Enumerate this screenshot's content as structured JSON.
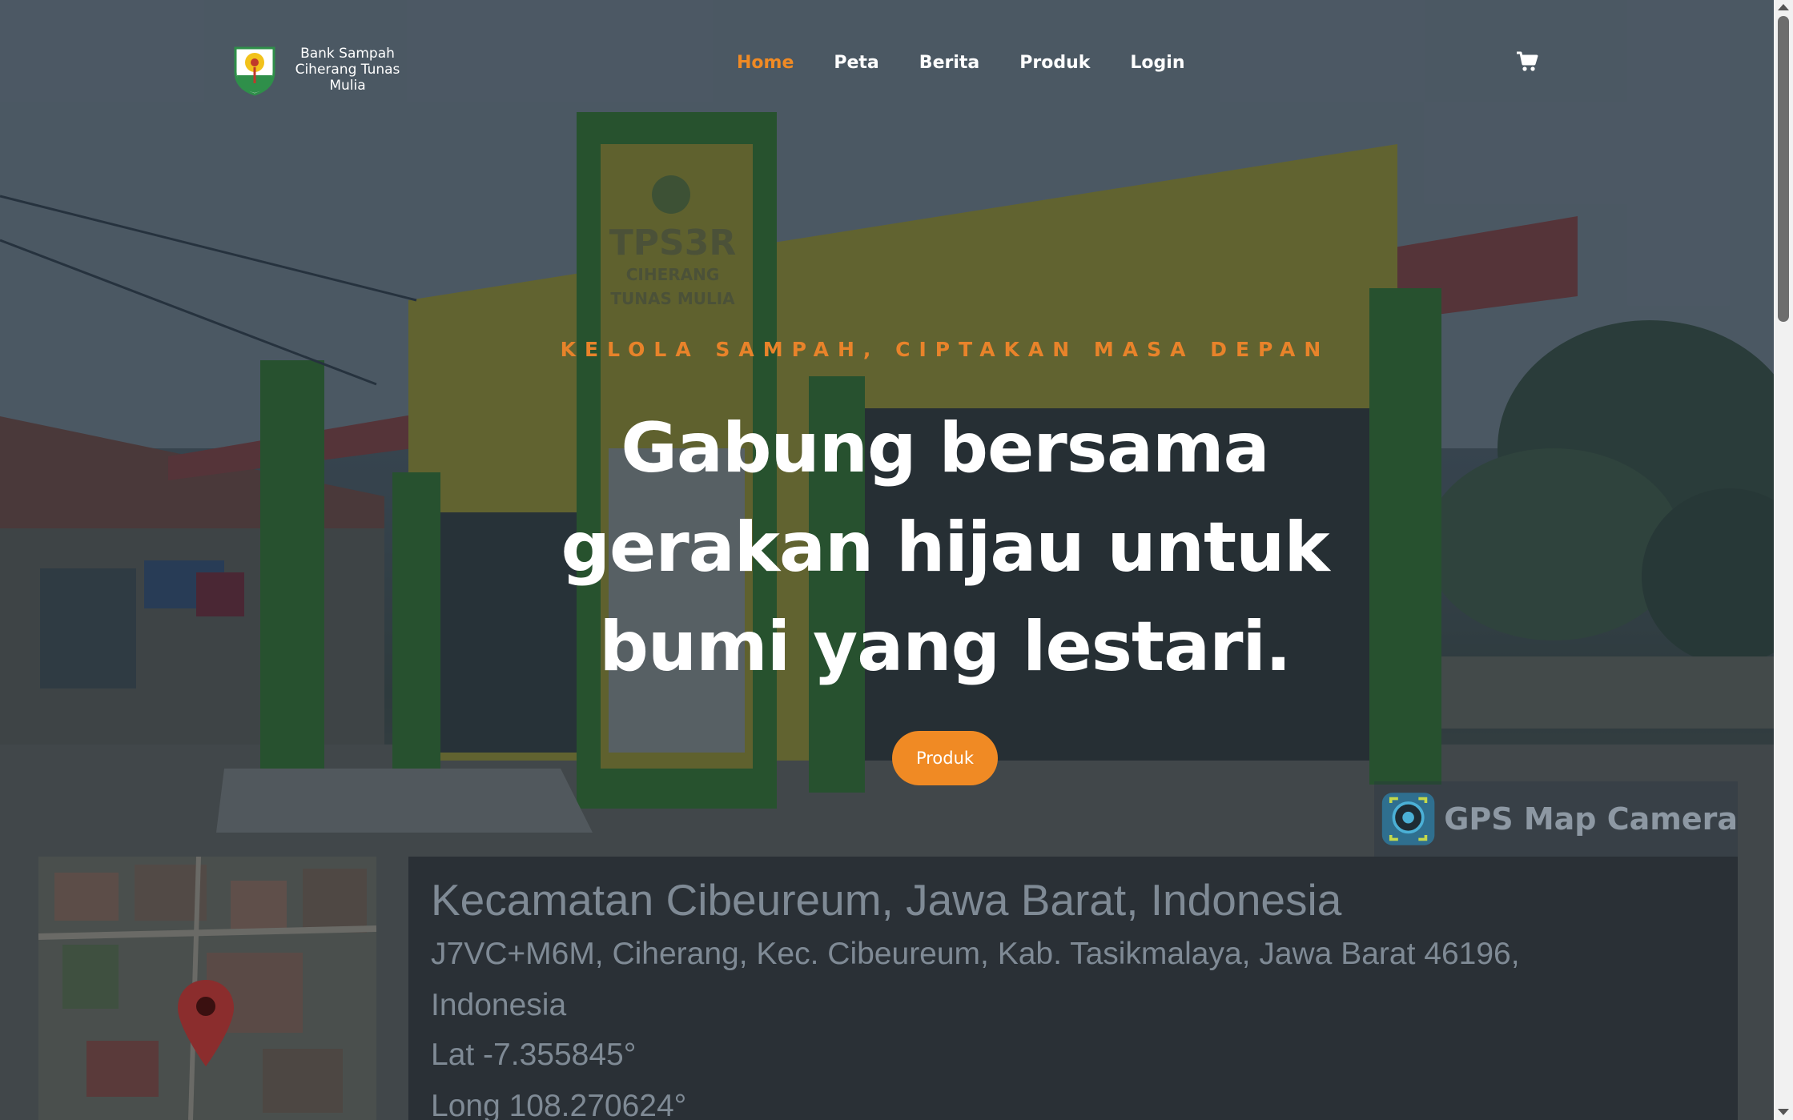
{
  "navbar": {
    "brand_name": "Bank Sampah Ciherang Tunas Mulia",
    "links": [
      {
        "label": "Home",
        "active": true
      },
      {
        "label": "Peta",
        "active": false
      },
      {
        "label": "Berita",
        "active": false
      },
      {
        "label": "Produk",
        "active": false
      },
      {
        "label": "Login",
        "active": false
      }
    ],
    "cart_icon": "shopping-cart-icon"
  },
  "hero": {
    "tagline": "KELOLA SAMPAH, CIPTAKAN MASA DEPAN",
    "headline": "Gabung bersama gerakan hijau untuk bumi yang lestari.",
    "cta_label": "Produk"
  },
  "photo": {
    "gps_badge": "GPS Map Camera",
    "location_title": "Kecamatan Cibeureum, Jawa Barat, Indonesia",
    "address_line1": "J7VC+M6M, Ciherang, Kec. Cibeureum, Kab. Tasikmalaya, Jawa Barat 46196,",
    "address_line2": "Indonesia",
    "lat": "Lat -7.355845°",
    "long": "Long 108.270624°"
  },
  "colors": {
    "accent": "#f08a24",
    "overlay": "#162230",
    "text": "#ffffff"
  }
}
